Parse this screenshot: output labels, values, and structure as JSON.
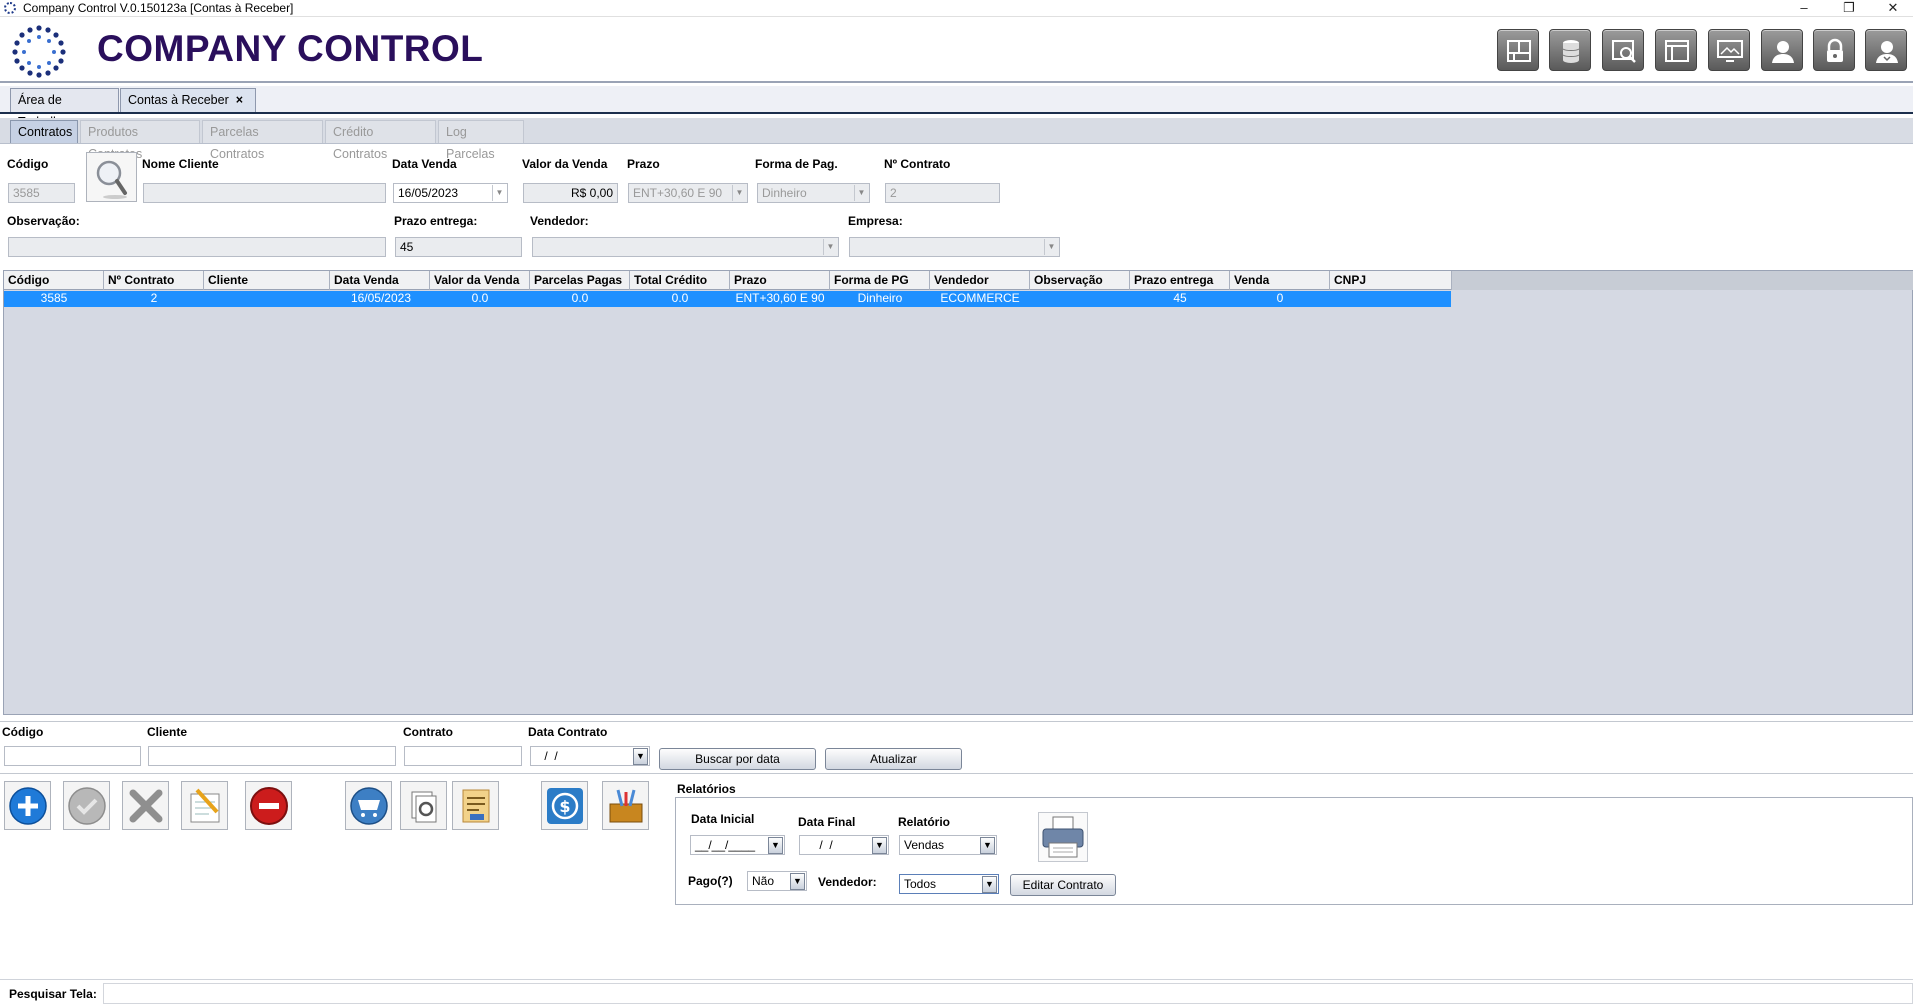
{
  "window": {
    "title": "Company Control V.0.150123a [Contas à Receber]",
    "minimize": "–",
    "restore": "❐",
    "close": "✕"
  },
  "header": {
    "brand": "COMPANY CONTROL",
    "toolbar_icons": [
      "network-icon",
      "database-icon",
      "search-window-icon",
      "layout-icon",
      "monitor-icon",
      "user-icon",
      "lock-icon",
      "user-admin-icon"
    ]
  },
  "main_tabs": [
    {
      "label": "Área de Trabalho"
    },
    {
      "label": "Contas à Receber",
      "close": "×"
    }
  ],
  "sub_tabs": [
    "Contratos",
    "Produtos Contratos",
    "Parcelas Contratos",
    "Crédito Contratos",
    "Log Parcelas"
  ],
  "form": {
    "codigo_label": "Código",
    "codigo_value": "3585",
    "nome_cliente_label": "Nome Cliente",
    "nome_cliente_value": "",
    "data_venda_label": "Data Venda",
    "data_venda_value": "16/05/2023",
    "valor_venda_label": "Valor da Venda",
    "valor_venda_value": "R$ 0,00",
    "prazo_label": "Prazo",
    "prazo_value": "ENT+30,60 E 90",
    "forma_pag_label": "Forma de Pag.",
    "forma_pag_value": "Dinheiro",
    "contrato_label": "Nº Contrato",
    "contrato_value": "2",
    "observacao_label": "Observação:",
    "observacao_value": "",
    "prazo_entrega_label": "Prazo entrega:",
    "prazo_entrega_value": "45",
    "vendedor_label": "Vendedor:",
    "vendedor_value": "",
    "empresa_label": "Empresa:",
    "empresa_value": ""
  },
  "table": {
    "columns": [
      "Código",
      "Nº Contrato",
      "Cliente",
      "Data Venda",
      "Valor da Venda",
      "Parcelas Pagas",
      "Total Crédito",
      "Prazo",
      "Forma de PG",
      "Vendedor",
      "Observação",
      "Prazo entrega",
      "Venda",
      "CNPJ"
    ],
    "rows": [
      [
        "3585",
        "2",
        "",
        "16/05/2023",
        "0.0",
        "0.0",
        "0.0",
        "ENT+30,60 E 90",
        "Dinheiro",
        "ECOMMERCE",
        "",
        "45",
        "0",
        ""
      ]
    ]
  },
  "filter": {
    "codigo_label": "Código",
    "cliente_label": "Cliente",
    "contrato_label": "Contrato",
    "data_contrato_label": "Data Contrato",
    "data_contrato_value": " /  /",
    "buscar_button": "Buscar por data",
    "atualizar_button": "Atualizar"
  },
  "actions": [
    "add-icon",
    "confirm-icon",
    "delete-icon",
    "edit-icon",
    "remove-icon",
    "cart-icon",
    "settings-docs-icon",
    "report-doc-icon",
    "payment-icon",
    "tools-icon"
  ],
  "relatorios": {
    "title": "Relatórios",
    "data_inicial_label": "Data Inicial",
    "data_inicial_value": "__/__/____",
    "data_final_label": "Data Final",
    "data_final_value": " /  /",
    "relatorio_label": "Relatório",
    "relatorio_value": "Vendas",
    "pago_label": "Pago(?)",
    "pago_value": "Não",
    "vendedor_label": "Vendedor:",
    "vendedor_value": "Todos",
    "editar_button": "Editar Contrato"
  },
  "status": {
    "pesquisar_label": "Pesquisar Tela:",
    "pesquisar_value": ""
  }
}
